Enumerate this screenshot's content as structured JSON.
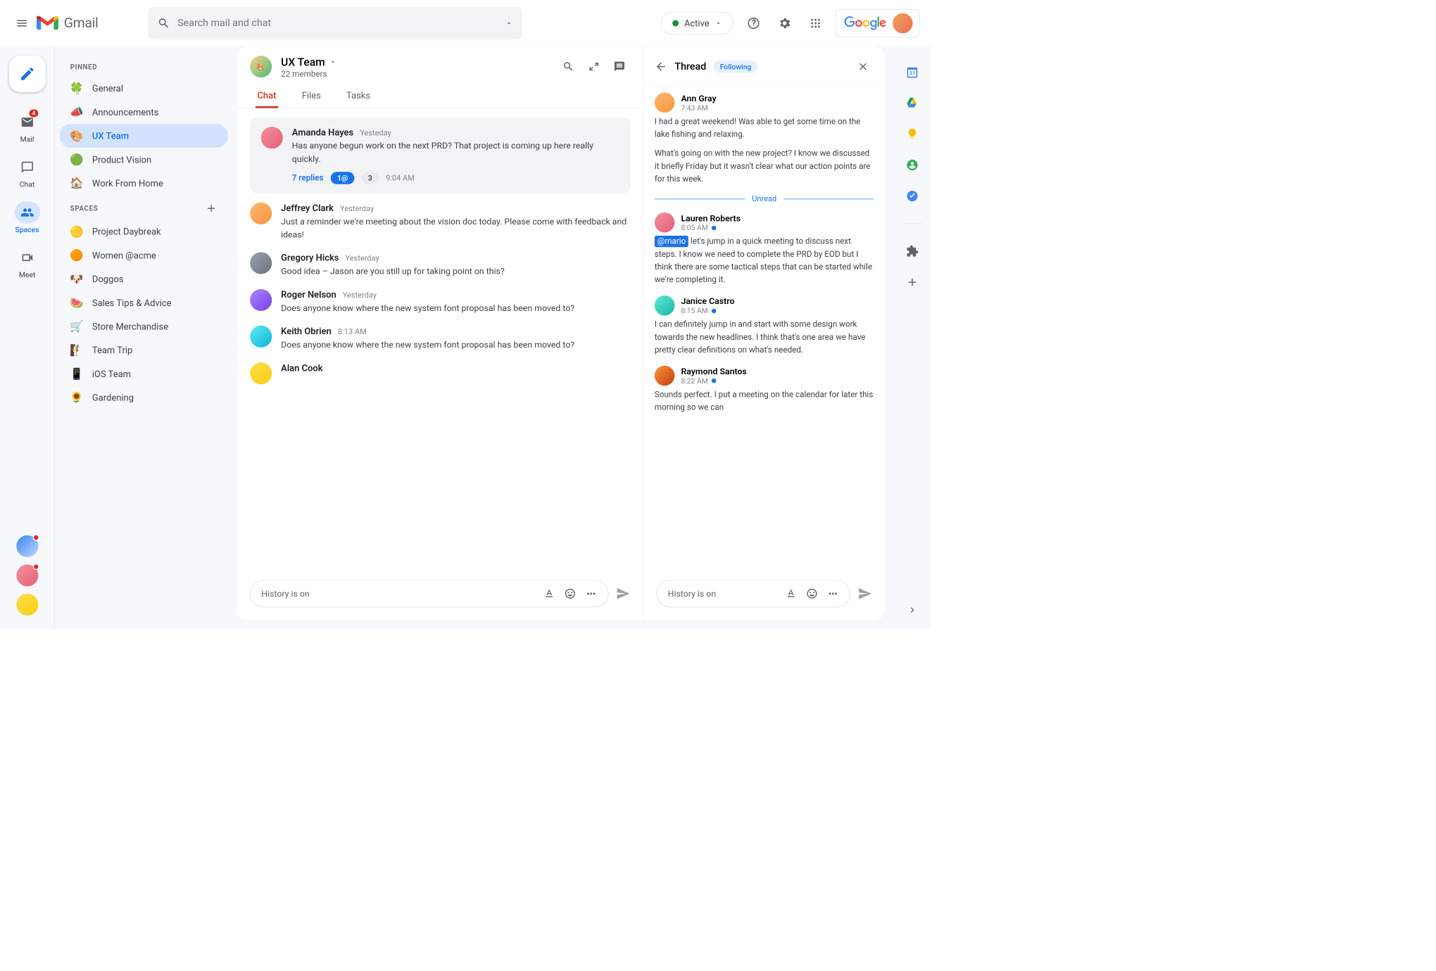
{
  "header": {
    "app_name": "Gmail",
    "search_placeholder": "Search mail and chat",
    "status_label": "Active",
    "google_label": "Google"
  },
  "rail": {
    "mail_label": "Mail",
    "mail_badge": "4",
    "chat_label": "Chat",
    "spaces_label": "Spaces",
    "meet_label": "Meet"
  },
  "sidebar": {
    "pinned_label": "PINNED",
    "spaces_label": "SPACES",
    "pinned": [
      {
        "emoji": "🍀",
        "label": "General"
      },
      {
        "emoji": "📣",
        "label": "Announcements"
      },
      {
        "emoji": "🎨",
        "label": "UX Team",
        "active": true
      },
      {
        "emoji": "🟢",
        "label": "Product Vision"
      },
      {
        "emoji": "🏠",
        "label": "Work From Home"
      }
    ],
    "spaces": [
      {
        "emoji": "🟡",
        "label": "Project Daybreak"
      },
      {
        "emoji": "🟠",
        "label": "Women @acme"
      },
      {
        "emoji": "🐶",
        "label": "Doggos"
      },
      {
        "emoji": "🍉",
        "label": "Sales Tips & Advice"
      },
      {
        "emoji": "🛒",
        "label": "Store Merchandise"
      },
      {
        "emoji": "🧗",
        "label": "Team Trip"
      },
      {
        "emoji": "📱",
        "label": "iOS Team"
      },
      {
        "emoji": "🌻",
        "label": "Gardening"
      }
    ]
  },
  "chat": {
    "title": "UX Team",
    "subtitle": "22 members",
    "tabs": {
      "chat": "Chat",
      "files": "Files",
      "tasks": "Tasks"
    },
    "pinned_msg": {
      "name": "Amanda Hayes",
      "time": "Yesteday",
      "text": "Has anyone begun work on the next PRD? That project is coming up here really quickly.",
      "reply_count": "7 replies",
      "mention_count": "1@",
      "other_count": "3",
      "last_time": "9:04 AM"
    },
    "messages": [
      {
        "name": "Jeffrey Clark",
        "time": "Yesterday",
        "text": "Just a reminder we're meeting about the vision doc today. Please come with feedback and ideas!"
      },
      {
        "name": "Gregory Hicks",
        "time": "Yesterday",
        "text": "Good idea – Jason are you still up for taking point on this?"
      },
      {
        "name": "Roger Nelson",
        "time": "Yesterday",
        "text": "Does anyone know where the new system font proposal has been moved to?"
      },
      {
        "name": "Keith Obrien",
        "time": "8:13 AM",
        "text": "Does anyone know where the new system font proposal has been moved to?"
      },
      {
        "name": "Alan Cook",
        "time": "",
        "text": ""
      }
    ],
    "compose_placeholder": "History is on"
  },
  "thread": {
    "title": "Thread",
    "following_label": "Following",
    "messages": [
      {
        "name": "Ann Gray",
        "time": "7:43 AM",
        "unread": false,
        "text": "I had a great weekend! Was able to get some time on the lake fishing and relaxing.",
        "text2": "What's going on with the new project? I know we discussed it briefly Friday but it wasn't clear what our action points are for this week."
      },
      {
        "name": "Lauren Roberts",
        "time": "8:05 AM",
        "unread": true,
        "mention": "@mario",
        "text": "let's jump in a quick meeting to discuss next steps. I know we need to complete the PRD by EOD but I think there are some tactical steps that can be started while we're completing it."
      },
      {
        "name": "Janice Castro",
        "time": "8:15 AM",
        "unread": true,
        "text": "I can definitely jump in and start with some design work towards the new headlines. I think that's one area we have pretty clear definitions on what's needed."
      },
      {
        "name": "Raymond Santos",
        "time": "8:22 AM",
        "unread": true,
        "text": "Sounds perfect. I put a meeting on the calendar for later this morning so we can"
      }
    ],
    "unread_label": "Unread",
    "compose_placeholder": "History is on"
  }
}
